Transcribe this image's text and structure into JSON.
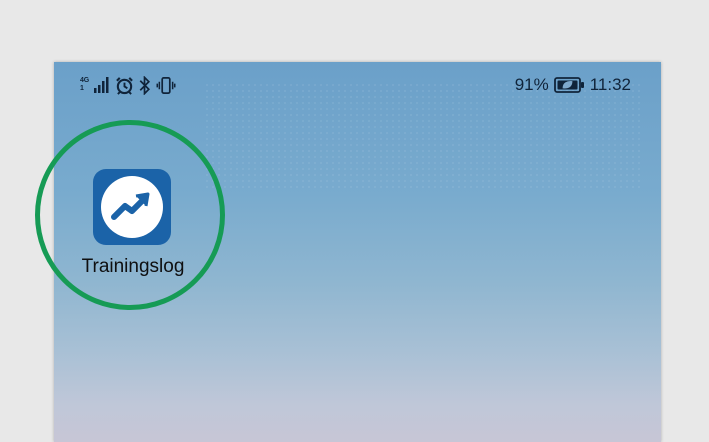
{
  "status_bar": {
    "network_type": "4G",
    "network_sub": "⁺",
    "network_sub2": "1",
    "battery_percent": "91%",
    "time": "11:32"
  },
  "icons": {
    "signal": "signal-bars-icon",
    "alarm": "alarm-clock-icon",
    "bluetooth": "bluetooth-icon",
    "vibrate": "vibrate-icon",
    "battery": "battery-eco-icon",
    "app": "trending-up-icon"
  },
  "home_screen": {
    "apps": [
      {
        "label": "Trainingslog"
      }
    ]
  },
  "colors": {
    "highlight_ring": "#169b55",
    "app_icon_bg": "#1b63a8",
    "app_icon_fg": "#1b63a8"
  }
}
